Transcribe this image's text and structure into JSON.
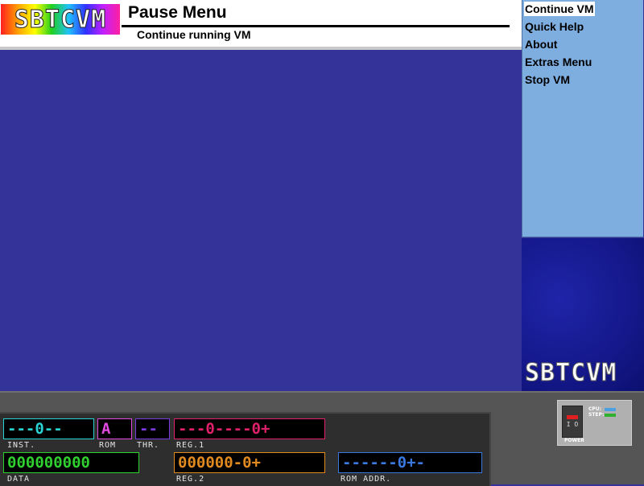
{
  "app": {
    "logo_text": "SBTCVM",
    "side_logo_text": "SBTCVM"
  },
  "header": {
    "title": "Pause Menu",
    "subtitle": "Continue running VM"
  },
  "menu": {
    "items": [
      {
        "label": "Continue VM",
        "selected": true
      },
      {
        "label": "Quick Help",
        "selected": false
      },
      {
        "label": "About",
        "selected": false
      },
      {
        "label": "Extras Menu",
        "selected": false
      },
      {
        "label": "Stop VM",
        "selected": false
      }
    ]
  },
  "registers": {
    "inst": {
      "value": "---0--",
      "label": "INST.",
      "color": "#29d3d3"
    },
    "rom": {
      "value": "A",
      "label": "ROM",
      "color": "#e04ae0"
    },
    "thr": {
      "value": "--",
      "label": "THR.",
      "color": "#7b3ae0"
    },
    "reg1": {
      "value": "---0----0+",
      "label": "REG.1",
      "color": "#e0206a"
    },
    "data": {
      "value": "000000000",
      "label": "DATA",
      "color": "#2fd02f"
    },
    "reg2": {
      "value": "000000-0+",
      "label": "REG.2",
      "color": "#e08a20"
    },
    "rom_addr": {
      "value": "------0+-",
      "label": "ROM ADDR.",
      "color": "#3a7ae0"
    }
  },
  "power": {
    "label": "POWER",
    "switch_text": "I O",
    "cpu_label": "CPU:",
    "step_label": "STEP:",
    "cpu_color": "#4aa0e0",
    "step_color": "#2fb02f"
  },
  "colors": {
    "main_bg": "#333399",
    "menu_bg": "#7eaee0",
    "bottom_bg": "#555555"
  }
}
